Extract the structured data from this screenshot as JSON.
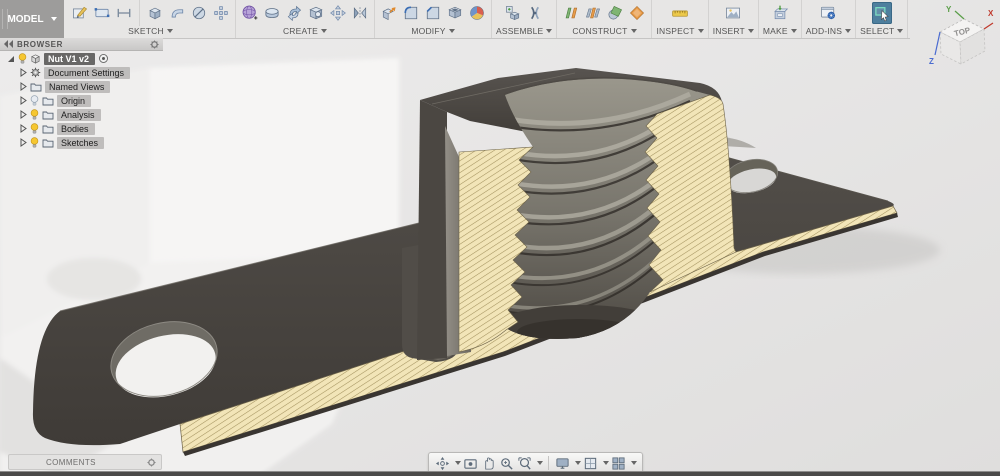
{
  "workspace_switcher": {
    "label": "MODEL"
  },
  "toolbar": {
    "groups": [
      {
        "label": "SKETCH",
        "icons": [
          "create-sketch-icon",
          "rectangle-icon",
          "line-icon",
          "project-icon",
          "sweep-profile-icon",
          "revolve-circle-icon",
          "points-icon"
        ]
      },
      {
        "label": "CREATE",
        "icons": [
          "create-form-icon",
          "revolve-icon",
          "sweep-icon",
          "coil-icon",
          "pattern-icon",
          "mirror-icon"
        ]
      },
      {
        "label": "MODIFY",
        "icons": [
          "press-pull-icon",
          "fillet-icon",
          "chamfer-icon",
          "shell-icon",
          "appearance-icon"
        ]
      },
      {
        "label": "ASSEMBLE",
        "icons": [
          "new-component-icon",
          "joint-icon"
        ]
      },
      {
        "label": "CONSTRUCT",
        "icons": [
          "offset-plane-icon",
          "midplane-icon",
          "tangent-plane-icon",
          "angled-plane-icon"
        ]
      },
      {
        "label": "INSPECT",
        "icons": [
          "measure-icon"
        ]
      },
      {
        "label": "INSERT",
        "icons": [
          "insert-media-icon"
        ]
      },
      {
        "label": "MAKE",
        "icons": [
          "make-icon"
        ]
      },
      {
        "label": "ADD-INS",
        "icons": [
          "add-ins-icon"
        ]
      },
      {
        "label": "SELECT",
        "icons": [
          "select-icon"
        ],
        "active": true
      }
    ]
  },
  "browser": {
    "title": "BROWSER",
    "root": {
      "label": "Nut V1 v2",
      "bulb": "on"
    },
    "items": [
      {
        "label": "Document Settings",
        "icon": "gear-icon",
        "bulb": "none"
      },
      {
        "label": "Named Views",
        "icon": "folder-icon",
        "bulb": "none"
      },
      {
        "label": "Origin",
        "icon": "folder-icon",
        "bulb": "off"
      },
      {
        "label": "Analysis",
        "icon": "folder-icon",
        "bulb": "on"
      },
      {
        "label": "Bodies",
        "icon": "folder-icon",
        "bulb": "on"
      },
      {
        "label": "Sketches",
        "icon": "folder-icon",
        "bulb": "on"
      }
    ]
  },
  "viewcube": {
    "top_label": "TOP",
    "axis_x": "X",
    "axis_y": "Y",
    "axis_z": "Z"
  },
  "comments": {
    "label": "COMMENTS"
  },
  "navbar": {
    "icons": [
      "orbit-icon",
      "look-at-icon",
      "pan-icon",
      "zoom-icon",
      "fit-icon",
      "display-settings-icon",
      "grid-settings-icon",
      "viewports-icon"
    ]
  },
  "scene": {
    "colors": {
      "plate": "#4a4641",
      "section_hatch": "#f2e5b8",
      "hatch_line": "#a3925e",
      "threads": "#8a877e",
      "background": "#e9e8e7"
    }
  },
  "colors": {
    "select_active": "#4e7f9e",
    "toolbar_bg": "#e7e6e5",
    "bulb_on": "#f6c731",
    "viewcube_x": "#c0392b",
    "viewcube_y": "#5a9e48",
    "viewcube_z": "#4a6bd0"
  }
}
